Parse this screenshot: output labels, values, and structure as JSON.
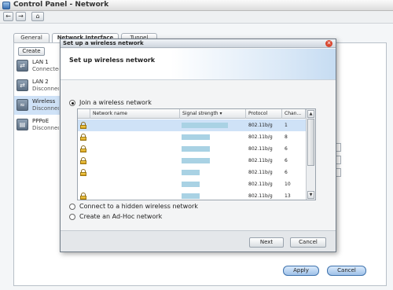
{
  "window": {
    "title": "Control Panel - Network"
  },
  "toolbar": {
    "back": "←",
    "forward": "→",
    "home": "⌂"
  },
  "tabs": [
    {
      "label": "General"
    },
    {
      "label": "Network Interface"
    },
    {
      "label": "Tunnel"
    }
  ],
  "sidebar": {
    "create_label": "Create",
    "items": [
      {
        "name": "LAN 1",
        "status": "Connected",
        "icon": "ethernet-icon"
      },
      {
        "name": "LAN 2",
        "status": "Disconnected",
        "icon": "ethernet-icon"
      },
      {
        "name": "Wireless",
        "status": "Disconnected",
        "icon": "wifi-icon"
      },
      {
        "name": "PPPoE",
        "status": "Disconnected",
        "icon": "modem-icon"
      }
    ]
  },
  "footer": {
    "apply_label": "Apply",
    "cancel_label": "Cancel"
  },
  "dialog": {
    "title": "Set up a wireless network",
    "heading": "Set up wireless network",
    "close": "✕",
    "option_join": "Join a wireless network",
    "option_hidden": "Connect to a hidden wireless network",
    "option_adhoc": "Create an Ad-Hoc network",
    "selected_option": "join",
    "table": {
      "headers": {
        "name": "Network name",
        "signal": "Signal strength",
        "sort": "▾",
        "protocol": "Protocol",
        "channel": "Chan..."
      },
      "rows": [
        {
          "secured": true,
          "signal": 0.82,
          "protocol": "802.11b/g",
          "channel": "1",
          "selected": true
        },
        {
          "secured": true,
          "signal": 0.5,
          "protocol": "802.11b/g",
          "channel": "8",
          "selected": false
        },
        {
          "secured": true,
          "signal": 0.5,
          "protocol": "802.11b/g",
          "channel": "6",
          "selected": false
        },
        {
          "secured": true,
          "signal": 0.5,
          "protocol": "802.11b/g",
          "channel": "6",
          "selected": false
        },
        {
          "secured": true,
          "signal": 0.32,
          "protocol": "802.11b/g",
          "channel": "6",
          "selected": false
        },
        {
          "secured": false,
          "signal": 0.32,
          "protocol": "802.11b/g",
          "channel": "10",
          "selected": false
        },
        {
          "secured": true,
          "signal": 0.32,
          "protocol": "802.11b/g",
          "channel": "13",
          "selected": false
        }
      ]
    },
    "next_label": "Next",
    "cancel_label": "Cancel"
  },
  "colors": {
    "accent": "#3f73ad",
    "selection": "#cfe2f7",
    "signal": "#a9d2e4",
    "close": "#d9472f"
  }
}
